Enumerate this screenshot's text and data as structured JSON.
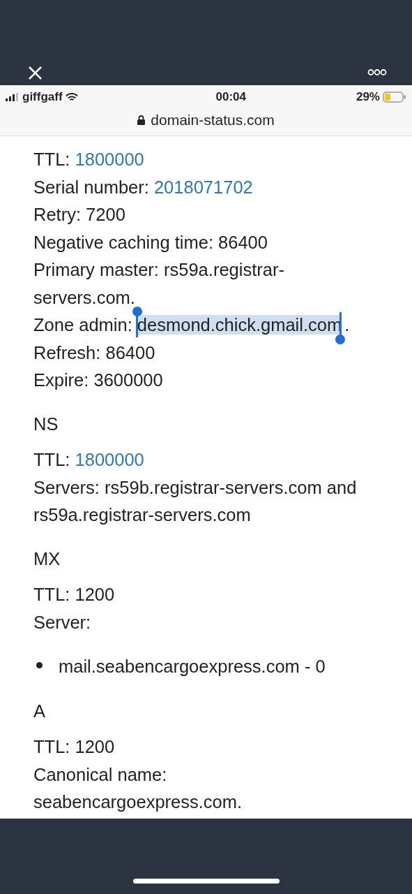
{
  "browser": {
    "carrier": "giffgaff",
    "time": "00:04",
    "battery": "29%",
    "url": "domain-status.com"
  },
  "sections": [
    {
      "items": [
        {
          "kind": "field",
          "label": "TTL:",
          "value": "1800000",
          "linked": true,
          "selected": false
        },
        {
          "kind": "field",
          "label": "Serial number:",
          "value": "2018071702",
          "linked": true,
          "selected": false
        },
        {
          "kind": "field",
          "label": "Retry:",
          "value": "7200",
          "linked": false,
          "selected": false
        },
        {
          "kind": "field",
          "label": "Negative caching time:",
          "value": "86400",
          "linked": false,
          "selected": false
        },
        {
          "kind": "field",
          "label": "Primary master:",
          "value": "rs59a.registrar-servers.com.",
          "linked": false,
          "selected": false
        },
        {
          "kind": "field",
          "label": "Zone admin:",
          "value": "desmond.chick.gmail.com",
          "suffix": ".",
          "linked": false,
          "selected": true
        },
        {
          "kind": "field",
          "label": "Refresh:",
          "value": "86400",
          "linked": false,
          "selected": false
        },
        {
          "kind": "field",
          "label": "Expire:",
          "value": "3600000",
          "linked": false,
          "selected": false
        }
      ]
    },
    {
      "heading": "NS",
      "items": [
        {
          "kind": "field",
          "label": "TTL:",
          "value": "1800000",
          "linked": true,
          "selected": false
        },
        {
          "kind": "field",
          "label": "Servers:",
          "value": "rs59b.registrar-servers.com and",
          "value_continued": "rs59a.registrar-servers.com",
          "linked": false,
          "selected": false
        }
      ]
    },
    {
      "heading": "MX",
      "items": [
        {
          "kind": "field",
          "label": "TTL:",
          "value": "1200",
          "linked": false,
          "selected": false
        },
        {
          "kind": "field",
          "label": "Server:"
        },
        {
          "kind": "bullet",
          "text": "mail.seabencargoexpress.com - 0"
        }
      ]
    },
    {
      "heading": "A",
      "items": [
        {
          "kind": "field",
          "label": "TTL:",
          "value": "1200",
          "linked": false,
          "selected": false
        },
        {
          "kind": "field",
          "label": "Canonical name:",
          "value": "seabencargoexpress.com.",
          "linked": false,
          "selected": false
        }
      ]
    }
  ]
}
